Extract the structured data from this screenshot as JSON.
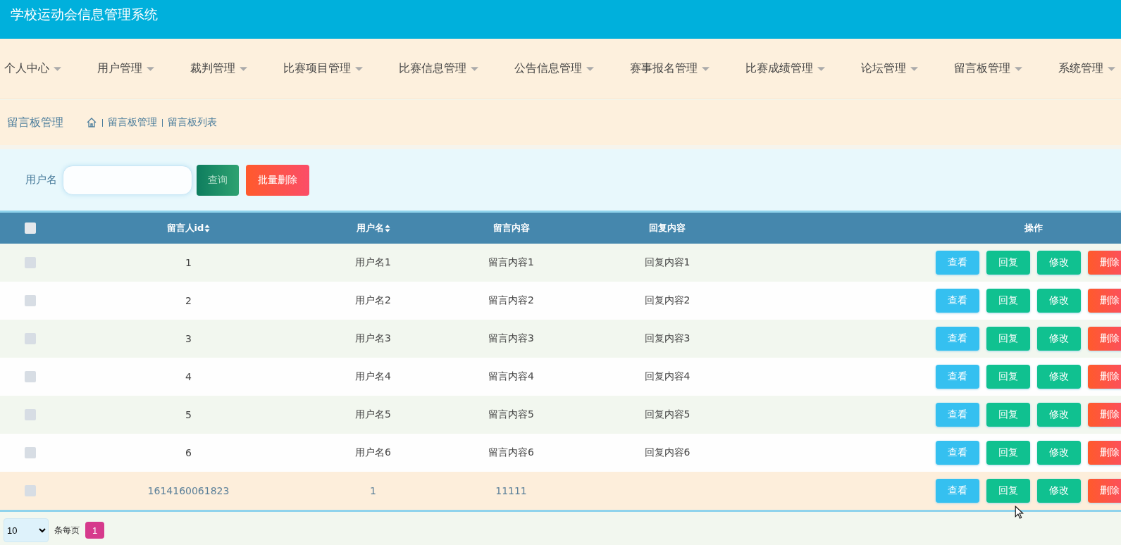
{
  "header": {
    "title": "学校运动会信息管理系统"
  },
  "nav": [
    {
      "label": "个人中心"
    },
    {
      "label": "用户管理"
    },
    {
      "label": "裁判管理"
    },
    {
      "label": "比赛项目管理"
    },
    {
      "label": "比赛信息管理"
    },
    {
      "label": "公告信息管理"
    },
    {
      "label": "赛事报名管理"
    },
    {
      "label": "比赛成绩管理"
    },
    {
      "label": "论坛管理"
    },
    {
      "label": "留言板管理"
    },
    {
      "label": "系统管理"
    }
  ],
  "breadcrumb": {
    "title": "留言板管理",
    "path": [
      "留言板管理",
      "留言板列表"
    ]
  },
  "search": {
    "label": "用户名",
    "search_button": "查询",
    "batch_delete_button": "批量删除"
  },
  "table": {
    "columns": [
      {
        "label": "留言人id",
        "sortable": true
      },
      {
        "label": "用户名",
        "sortable": true
      },
      {
        "label": "留言内容",
        "sortable": false
      },
      {
        "label": "回复内容",
        "sortable": false
      },
      {
        "label": "操作",
        "sortable": false
      }
    ],
    "select_all": {
      "checked": false
    },
    "rows": [
      {
        "checked": false,
        "hovered": false,
        "cells": [
          "1",
          "用户名1",
          "留言内容1",
          "回复内容1"
        ],
        "actions": [
          {
            "label": "查看",
            "kind": "view"
          },
          {
            "label": "回复",
            "kind": "reply"
          },
          {
            "label": "修改",
            "kind": "edit"
          },
          {
            "label": "删除",
            "kind": "delete"
          }
        ]
      },
      {
        "checked": false,
        "hovered": false,
        "cells": [
          "2",
          "用户名2",
          "留言内容2",
          "回复内容2"
        ],
        "actions": [
          {
            "label": "查看",
            "kind": "view"
          },
          {
            "label": "回复",
            "kind": "reply"
          },
          {
            "label": "修改",
            "kind": "edit"
          },
          {
            "label": "删除",
            "kind": "delete"
          }
        ]
      },
      {
        "checked": false,
        "hovered": false,
        "cells": [
          "3",
          "用户名3",
          "留言内容3",
          "回复内容3"
        ],
        "actions": [
          {
            "label": "查看",
            "kind": "view"
          },
          {
            "label": "回复",
            "kind": "reply"
          },
          {
            "label": "修改",
            "kind": "edit"
          },
          {
            "label": "删除",
            "kind": "delete"
          }
        ]
      },
      {
        "checked": false,
        "hovered": false,
        "cells": [
          "4",
          "用户名4",
          "留言内容4",
          "回复内容4"
        ],
        "actions": [
          {
            "label": "查看",
            "kind": "view"
          },
          {
            "label": "回复",
            "kind": "reply"
          },
          {
            "label": "修改",
            "kind": "edit"
          },
          {
            "label": "删除",
            "kind": "delete"
          }
        ]
      },
      {
        "checked": false,
        "hovered": false,
        "cells": [
          "5",
          "用户名5",
          "留言内容5",
          "回复内容5"
        ],
        "actions": [
          {
            "label": "查看",
            "kind": "view"
          },
          {
            "label": "回复",
            "kind": "reply"
          },
          {
            "label": "修改",
            "kind": "edit"
          },
          {
            "label": "删除",
            "kind": "delete"
          }
        ]
      },
      {
        "checked": false,
        "hovered": false,
        "cells": [
          "6",
          "用户名6",
          "留言内容6",
          "回复内容6"
        ],
        "actions": [
          {
            "label": "查看",
            "kind": "view"
          },
          {
            "label": "回复",
            "kind": "reply"
          },
          {
            "label": "修改",
            "kind": "edit"
          },
          {
            "label": "删除",
            "kind": "delete"
          }
        ]
      },
      {
        "checked": false,
        "hovered": true,
        "cells": [
          "1614160061823",
          "1",
          "11111",
          ""
        ],
        "actions": [
          {
            "label": "查看",
            "kind": "view"
          },
          {
            "label": "回复",
            "kind": "reply"
          },
          {
            "label": "修改",
            "kind": "edit"
          },
          {
            "label": "删除",
            "kind": "delete"
          }
        ]
      }
    ]
  },
  "pagination": {
    "page_size": "10",
    "per_page_label": "条每页",
    "pages": [
      {
        "label": "1",
        "selected": true
      }
    ]
  }
}
